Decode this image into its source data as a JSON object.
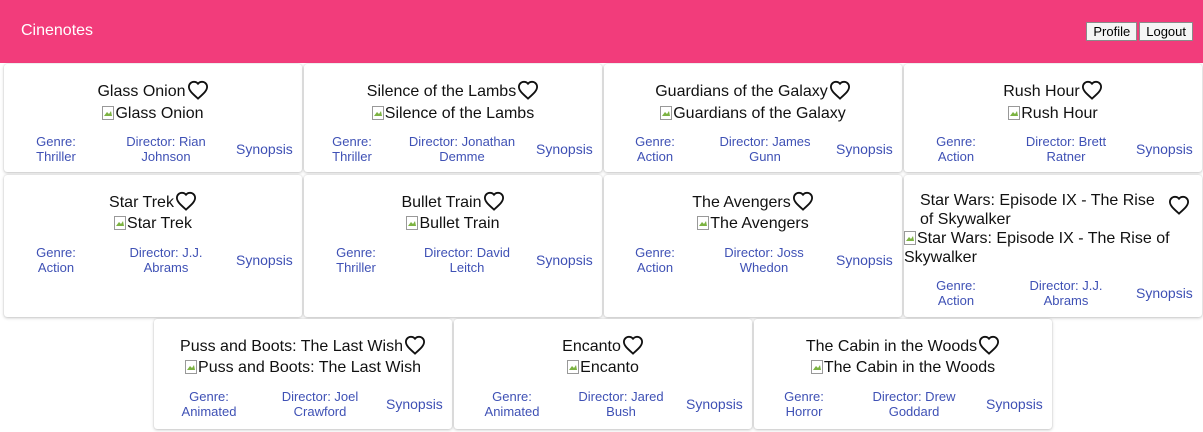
{
  "app": {
    "title": "Cinenotes"
  },
  "header": {
    "profile_label": "Profile",
    "logout_label": "Logout"
  },
  "movies": [
    {
      "title": "Glass Onion",
      "img_alt": "Glass Onion",
      "genre": "Genre: Thriller",
      "director": "Director: Rian Johnson",
      "synopsis": "Synopsis"
    },
    {
      "title": "Silence of the Lambs",
      "img_alt": "Silence of the Lambs",
      "genre": "Genre: Thriller",
      "director": "Director: Jonathan Demme",
      "synopsis": "Synopsis"
    },
    {
      "title": "Guardians of the Galaxy",
      "img_alt": "Guardians of the Galaxy",
      "genre": "Genre: Action",
      "director": "Director: James Gunn",
      "synopsis": "Synopsis"
    },
    {
      "title": "Rush Hour",
      "img_alt": "Rush Hour",
      "genre": "Genre: Action",
      "director": "Director: Brett Ratner",
      "synopsis": "Synopsis"
    },
    {
      "title": "Star Trek",
      "img_alt": "Star Trek",
      "genre": "Genre: Action",
      "director": "Director: J.J. Abrams",
      "synopsis": "Synopsis"
    },
    {
      "title": "Bullet Train",
      "img_alt": "Bullet Train",
      "genre": "Genre: Thriller",
      "director": "Director: David Leitch",
      "synopsis": "Synopsis"
    },
    {
      "title": "The Avengers",
      "img_alt": "The Avengers",
      "genre": "Genre: Action",
      "director": "Director: Joss Whedon",
      "synopsis": "Synopsis"
    },
    {
      "title": "Star Wars: Episode IX - The Rise of Skywalker",
      "img_alt": "Star Wars: Episode IX - The Rise of Skywalker",
      "genre": "Genre: Action",
      "director": "Director: J.J. Abrams",
      "synopsis": "Synopsis"
    },
    {
      "title": "Puss and Boots: The Last Wish",
      "img_alt": "Puss and Boots: The Last Wish",
      "genre": "Genre: Animated",
      "director": "Director: Joel Crawford",
      "synopsis": "Synopsis"
    },
    {
      "title": "Encanto",
      "img_alt": "Encanto",
      "genre": "Genre: Animated",
      "director": "Director: Jared Bush",
      "synopsis": "Synopsis"
    },
    {
      "title": "The Cabin in the Woods",
      "img_alt": "The Cabin in the Woods",
      "genre": "Genre: Horror",
      "director": "Director: Drew Goddard",
      "synopsis": "Synopsis"
    }
  ],
  "colors": {
    "header_bg": "#f23c7b",
    "link": "#3f51b5"
  },
  "icons": {
    "favorite": "heart-outline-icon",
    "image": "broken-image-icon"
  }
}
